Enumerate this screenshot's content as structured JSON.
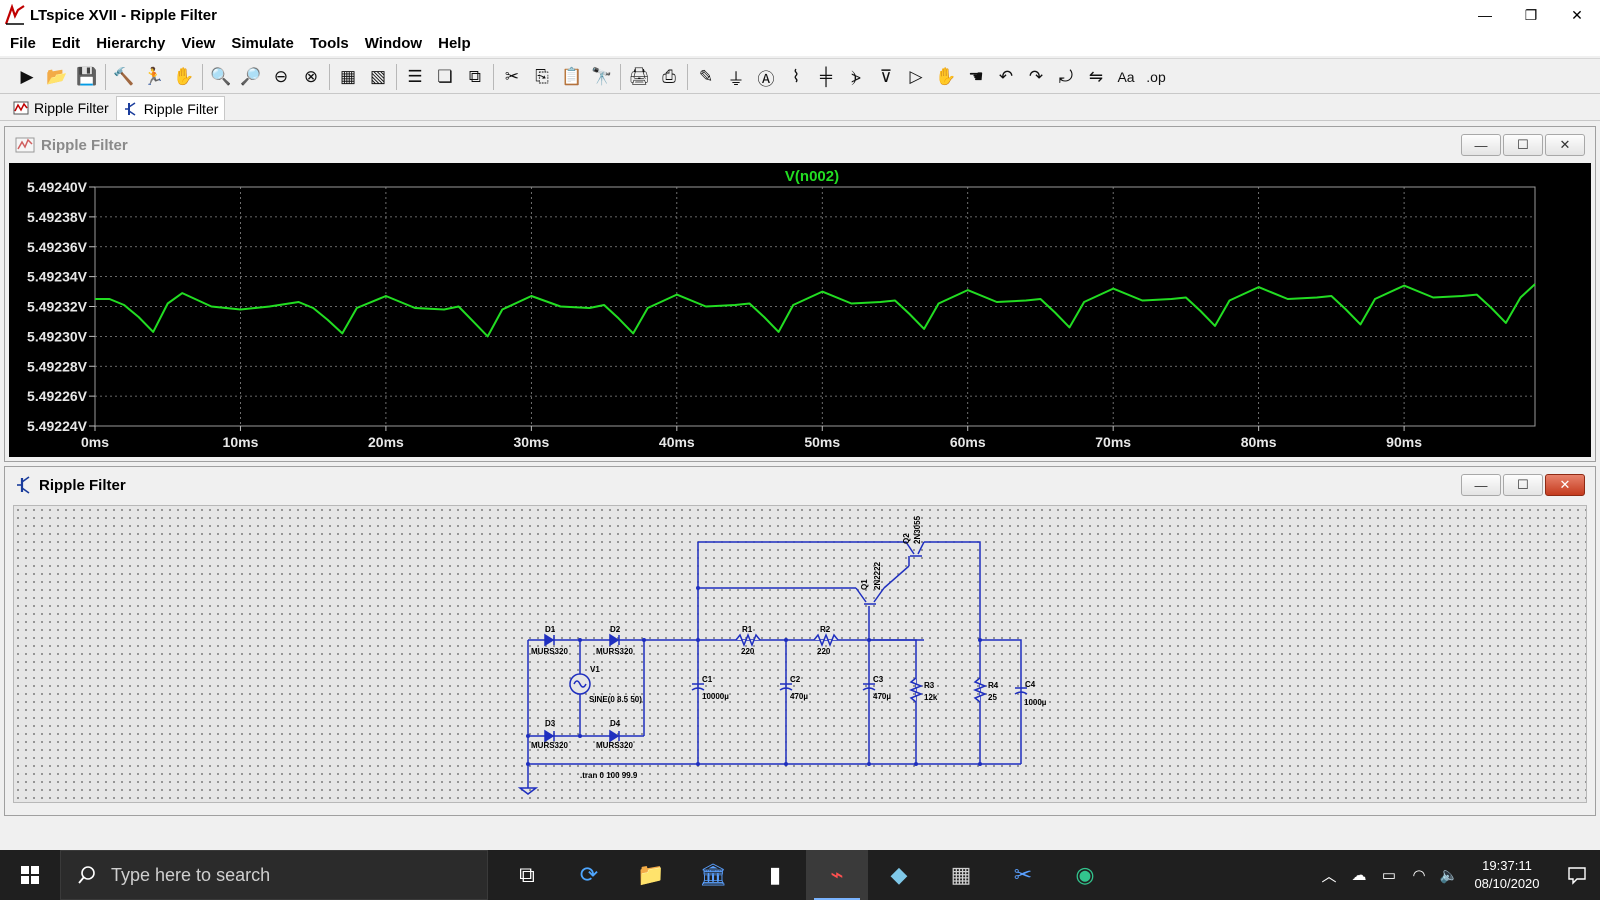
{
  "window": {
    "title": "LTspice XVII - Ripple Filter",
    "minimize_glyph": "—",
    "maximize_glyph": "❐",
    "close_glyph": "✕"
  },
  "menu": [
    "File",
    "Edit",
    "Hierarchy",
    "View",
    "Simulate",
    "Tools",
    "Window",
    "Help"
  ],
  "toolbar": {
    "icons": [
      {
        "name": "new-schematic-icon",
        "glyph": "▶"
      },
      {
        "name": "open-icon",
        "glyph": "📂"
      },
      {
        "name": "save-icon",
        "glyph": "💾"
      },
      {
        "sep": true
      },
      {
        "name": "control-panel-icon",
        "glyph": "🔨"
      },
      {
        "name": "run-icon",
        "glyph": "🏃"
      },
      {
        "name": "halt-icon",
        "glyph": "✋"
      },
      {
        "sep": true
      },
      {
        "name": "zoom-in-icon",
        "glyph": "🔍"
      },
      {
        "name": "zoom-pan-icon",
        "glyph": "🔎"
      },
      {
        "name": "zoom-out-icon",
        "glyph": "⊖"
      },
      {
        "name": "zoom-fit-icon",
        "glyph": "⊗"
      },
      {
        "sep": true
      },
      {
        "name": "autorange-icon",
        "glyph": "▦"
      },
      {
        "name": "delete-trace-icon",
        "glyph": "▧"
      },
      {
        "sep": true
      },
      {
        "name": "tile-horizontal-icon",
        "glyph": "☰"
      },
      {
        "name": "cascade-icon",
        "glyph": "❏"
      },
      {
        "name": "tile-vertical-icon",
        "glyph": "⧉"
      },
      {
        "sep": true
      },
      {
        "name": "cut-icon",
        "glyph": "✂"
      },
      {
        "name": "copy-icon",
        "glyph": "⎘"
      },
      {
        "name": "paste-icon",
        "glyph": "📋"
      },
      {
        "name": "find-icon",
        "glyph": "🔭"
      },
      {
        "sep": true
      },
      {
        "name": "print-icon",
        "glyph": "🖨"
      },
      {
        "name": "print-setup-icon",
        "glyph": "⎙"
      },
      {
        "sep": true
      },
      {
        "name": "wire-icon",
        "glyph": "✎"
      },
      {
        "name": "ground-icon",
        "glyph": "⏚"
      },
      {
        "name": "label-net-icon",
        "glyph": "Ⓐ"
      },
      {
        "name": "resistor-icon",
        "glyph": "⌇"
      },
      {
        "name": "capacitor-icon",
        "glyph": "╪"
      },
      {
        "name": "inductor-icon",
        "glyph": "⦔"
      },
      {
        "name": "diode-icon",
        "glyph": "⊽"
      },
      {
        "name": "component-icon",
        "glyph": "▷"
      },
      {
        "name": "move-icon",
        "glyph": "✋"
      },
      {
        "name": "drag-icon",
        "glyph": "☚"
      },
      {
        "name": "undo-icon",
        "glyph": "↶"
      },
      {
        "name": "redo-icon",
        "glyph": "↷"
      },
      {
        "name": "rotate-icon",
        "glyph": "⤾"
      },
      {
        "name": "mirror-icon",
        "glyph": "⇋"
      },
      {
        "name": "text-icon",
        "glyph": "Aa"
      },
      {
        "name": "spice-directive-icon",
        "glyph": ".op"
      }
    ]
  },
  "tabs": [
    {
      "label": "Ripple Filter",
      "type": "waveform",
      "active": false
    },
    {
      "label": "Ripple Filter",
      "type": "schematic",
      "active": true
    }
  ],
  "plot_window": {
    "title": "Ripple Filter",
    "min_glyph": "—",
    "max_glyph": "☐",
    "close_glyph": "✕"
  },
  "schematic_window": {
    "title": "Ripple Filter",
    "min_glyph": "—",
    "max_glyph": "☐",
    "close_glyph": "✕"
  },
  "chart_data": {
    "type": "line",
    "title": "V(n002)",
    "xlabel": "",
    "ylabel": "",
    "x_ticks": [
      "0ms",
      "10ms",
      "20ms",
      "30ms",
      "40ms",
      "50ms",
      "60ms",
      "70ms",
      "80ms",
      "90ms"
    ],
    "y_ticks": [
      "5.49224V",
      "5.49226V",
      "5.49228V",
      "5.49230V",
      "5.49232V",
      "5.49234V",
      "5.49236V",
      "5.49238V",
      "5.49240V"
    ],
    "xlim": [
      0,
      99
    ],
    "ylim": [
      5.49224,
      5.4924
    ],
    "grid": true,
    "line_color": "#22dd22",
    "background": "#000000",
    "series": [
      {
        "name": "V(n002)",
        "x": [
          0,
          1,
          2,
          3,
          4,
          5,
          6,
          8,
          10,
          12,
          14,
          15,
          16,
          17,
          18,
          20,
          22,
          24,
          25,
          26,
          27,
          28,
          30,
          32,
          34,
          35,
          36,
          37,
          38,
          40,
          42,
          44,
          45,
          46,
          47,
          48,
          50,
          52,
          54,
          55,
          56,
          57,
          58,
          60,
          62,
          64,
          65,
          66,
          67,
          68,
          70,
          72,
          74,
          75,
          76,
          77,
          78,
          80,
          82,
          84,
          85,
          86,
          87,
          88,
          90,
          92,
          94,
          95,
          96,
          97,
          98,
          99
        ],
        "y": [
          5.492325,
          5.492325,
          5.492321,
          5.492313,
          5.492303,
          5.492322,
          5.492329,
          5.49232,
          5.492318,
          5.49232,
          5.492323,
          5.492319,
          5.492311,
          5.492302,
          5.492319,
          5.492327,
          5.492319,
          5.492318,
          5.49232,
          5.49231,
          5.4923,
          5.492318,
          5.492327,
          5.49232,
          5.492319,
          5.492321,
          5.492312,
          5.492302,
          5.492319,
          5.492328,
          5.49232,
          5.492321,
          5.492322,
          5.492313,
          5.492303,
          5.492321,
          5.49233,
          5.492322,
          5.492323,
          5.492324,
          5.492315,
          5.492305,
          5.492322,
          5.492331,
          5.492323,
          5.492324,
          5.492325,
          5.492316,
          5.492306,
          5.492323,
          5.492332,
          5.492324,
          5.492325,
          5.492326,
          5.492317,
          5.492307,
          5.492324,
          5.492333,
          5.492325,
          5.492326,
          5.492327,
          5.492318,
          5.492308,
          5.492325,
          5.492334,
          5.492326,
          5.492327,
          5.492328,
          5.492319,
          5.492309,
          5.492326,
          5.492335
        ]
      }
    ]
  },
  "schematic": {
    "labels": {
      "d1": "D1",
      "d1_model": "MURS320",
      "d2": "D2",
      "d2_model": "MURS320",
      "d3": "D3",
      "d3_model": "MURS320",
      "d4": "D4",
      "d4_model": "MURS320",
      "v1": "V1",
      "v1_value": "SINE(0 8.5 50)",
      "c1": "C1",
      "c1_value": "10000µ",
      "c2": "C2",
      "c2_value": "470µ",
      "c3": "C3",
      "c3_value": "470µ",
      "c4": "C4",
      "c4_value": "1000µ",
      "r1": "R1",
      "r1_value": "220",
      "r2": "R2",
      "r2_value": "220",
      "r3": "R3",
      "r3_value": "12k",
      "r4": "R4",
      "r4_value": "25",
      "q1": "Q1",
      "q1_model": "2N2222",
      "q2": "Q2",
      "q2_model": "2N3055",
      "directive": ".tran 0 100 99.9"
    }
  },
  "taskbar": {
    "search_placeholder": "Type here to search",
    "time": "19:37:11",
    "date": "08/10/2020",
    "apps": [
      {
        "name": "task-view-icon",
        "glyph": "⧉",
        "color": "#ffffff"
      },
      {
        "name": "sync-app-icon",
        "glyph": "⟳",
        "color": "#4ea6ff"
      },
      {
        "name": "file-explorer-icon",
        "glyph": "📁",
        "color": "#f4c542"
      },
      {
        "name": "bank-app-icon",
        "glyph": "🏛",
        "color": "#5aa0ff"
      },
      {
        "name": "notepad-icon",
        "glyph": "▮",
        "color": "#ffffff"
      },
      {
        "name": "ltspice-app-icon",
        "glyph": "⌁",
        "color": "#ff5050"
      },
      {
        "name": "notes-app-icon",
        "glyph": "◆",
        "color": "#7fc8e8"
      },
      {
        "name": "calculator-icon",
        "glyph": "▦",
        "color": "#cfcfcf"
      },
      {
        "name": "snipping-tool-icon",
        "glyph": "✂",
        "color": "#5aa0ff"
      },
      {
        "name": "edge-browser-icon",
        "glyph": "◉",
        "color": "#32c48d"
      }
    ],
    "tray": [
      {
        "name": "show-hidden-icon",
        "glyph": "︿"
      },
      {
        "name": "onedrive-icon",
        "glyph": "☁"
      },
      {
        "name": "battery-icon",
        "glyph": "▭"
      },
      {
        "name": "wifi-icon",
        "glyph": "◠"
      },
      {
        "name": "volume-icon",
        "glyph": "🔈"
      }
    ]
  }
}
